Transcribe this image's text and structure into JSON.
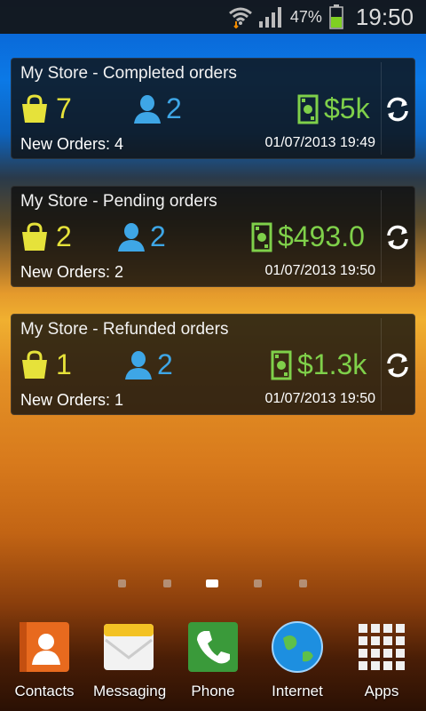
{
  "status_bar": {
    "battery_percent": "47%",
    "time": "19:50"
  },
  "widgets": [
    {
      "title": "My Store - Completed orders",
      "orders": "7",
      "customers": "2",
      "revenue": "$5k",
      "new_orders": "New Orders: 4",
      "timestamp": "01/07/2013 19:49"
    },
    {
      "title": "My Store - Pending orders",
      "orders": "2",
      "customers": "2",
      "revenue": "$493.0",
      "new_orders": "New Orders: 2",
      "timestamp": "01/07/2013 19:50"
    },
    {
      "title": "My Store - Refunded orders",
      "orders": "1",
      "customers": "2",
      "revenue": "$1.3k",
      "new_orders": "New Orders: 1",
      "timestamp": "01/07/2013 19:50"
    }
  ],
  "pager": {
    "pages": 5,
    "active_index": 2
  },
  "dock": {
    "items": [
      {
        "label": "Contacts",
        "icon": "contacts-icon"
      },
      {
        "label": "Messaging",
        "icon": "messaging-icon"
      },
      {
        "label": "Phone",
        "icon": "phone-icon"
      },
      {
        "label": "Internet",
        "icon": "internet-globe-icon"
      },
      {
        "label": "Apps",
        "icon": "apps-grid-icon"
      }
    ]
  },
  "colors": {
    "orders": "#e6e23a",
    "customers": "#3ea6e6",
    "revenue": "#7fd04a"
  }
}
